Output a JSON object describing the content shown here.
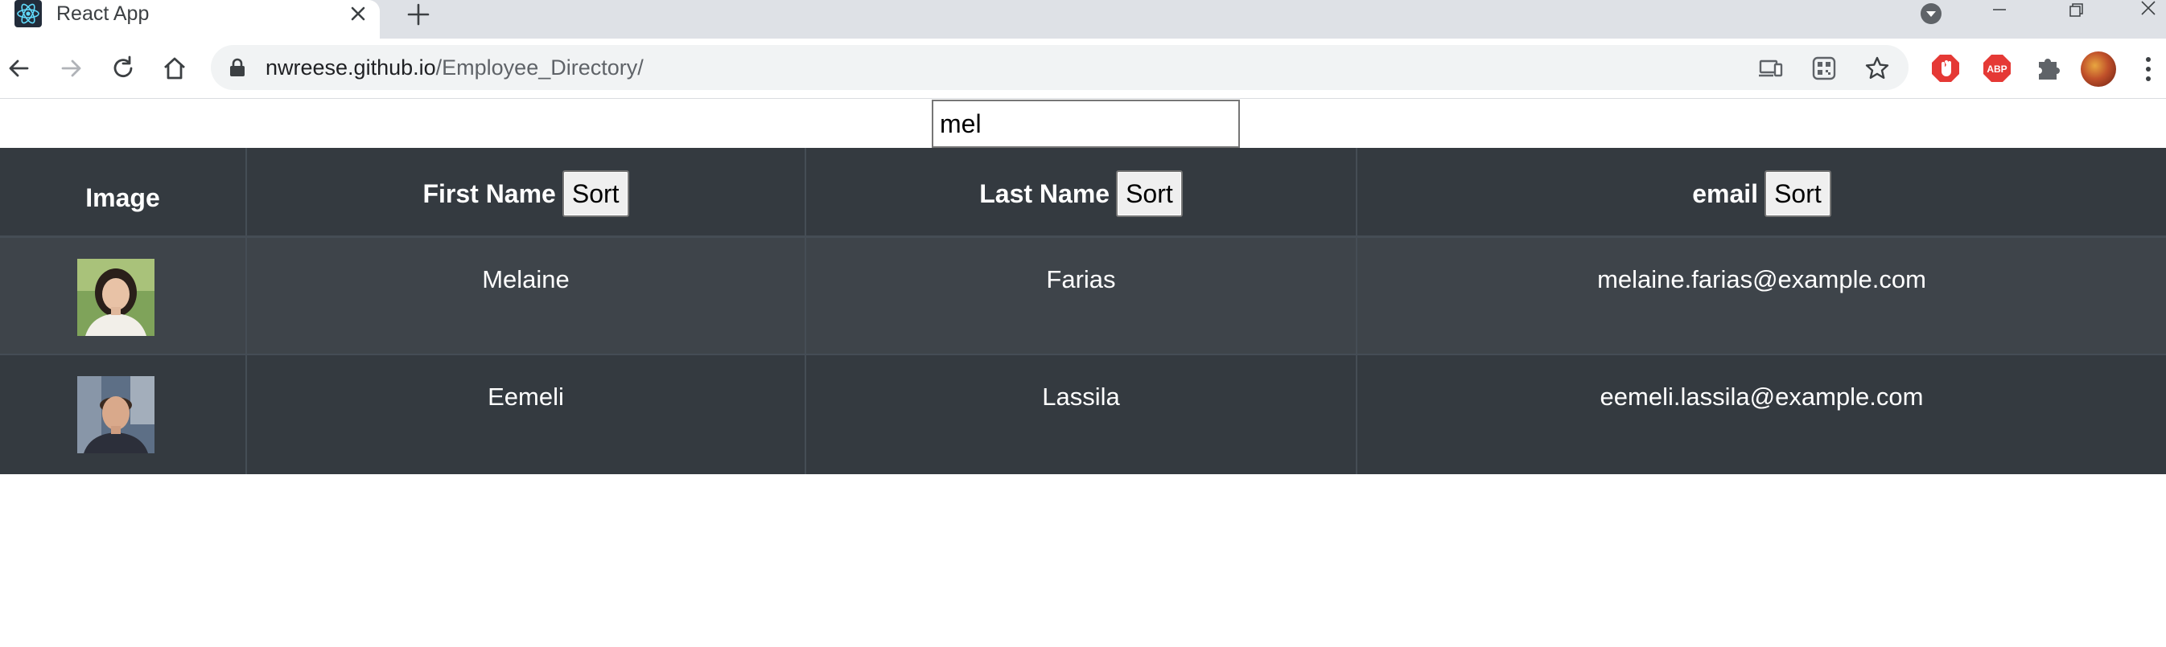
{
  "browser": {
    "tab_title": "React App",
    "url_host": "nwreese.github.io",
    "url_path": "/Employee_Directory/",
    "icons": [
      "react-favicon",
      "close-icon",
      "plus-icon",
      "tab-search-icon",
      "minimize-icon",
      "restore-icon",
      "window-close-icon",
      "back-icon",
      "forward-icon",
      "reload-icon",
      "home-icon",
      "lock-icon",
      "cast-icon",
      "qr-icon",
      "star-icon",
      "adblock-icon",
      "abp-icon",
      "puzzle-icon",
      "profile-avatar",
      "kebab-menu-icon"
    ]
  },
  "search": {
    "value": "mel"
  },
  "table": {
    "headers": {
      "image": "Image",
      "first_name": "First Name",
      "last_name": "Last Name",
      "email": "email",
      "sort_label": "Sort"
    },
    "rows": [
      {
        "first_name": "Melaine",
        "last_name": "Farias",
        "email": "melaine.farias@example.com"
      },
      {
        "first_name": "Eemeli",
        "last_name": "Lassila",
        "email": "eemeli.lassila@example.com"
      }
    ]
  },
  "colors": {
    "table_bg": "#343a40",
    "row_striped": "#3e444a",
    "tabstrip_bg": "#dee1e6",
    "omnibox_bg": "#f1f3f4"
  }
}
